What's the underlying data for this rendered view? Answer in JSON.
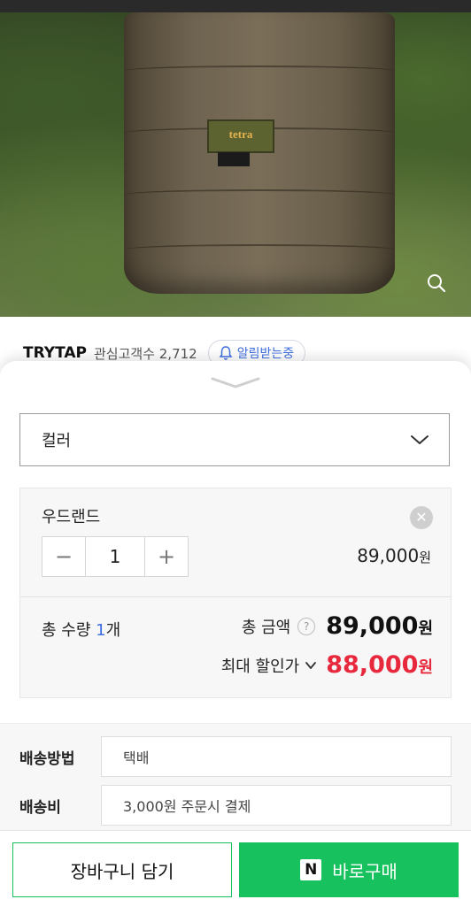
{
  "product": {
    "photo_label": "tetra",
    "brand": "TRYTAP",
    "interest_label": "관심고객수",
    "interest_count": "2,712",
    "alert_label": "알림받는중"
  },
  "options": {
    "select_label": "컬러",
    "selected": {
      "name": "우드랜드",
      "quantity": "1",
      "price": "89,000",
      "price_unit": "원",
      "remove_icon": "close-icon"
    }
  },
  "summary": {
    "total_qty_label": "총 수량",
    "total_qty_value": "1",
    "total_qty_unit": "개",
    "total_amount_label": "총 금액",
    "total_amount": "89,000",
    "total_amount_unit": "원",
    "max_discount_label": "최대 할인가",
    "max_discount_price": "88,000",
    "max_discount_unit": "원",
    "discount_color": "#e8283c"
  },
  "shipping": {
    "method_label": "배송방법",
    "method_value": "택배",
    "fee_label": "배송비",
    "fee_value": "3,000원 주문시 결제"
  },
  "actions": {
    "cart_label": "장바구니 담기",
    "buy_label": "바로구매",
    "npay_mark": "N",
    "brand_color": "#17c15d"
  }
}
